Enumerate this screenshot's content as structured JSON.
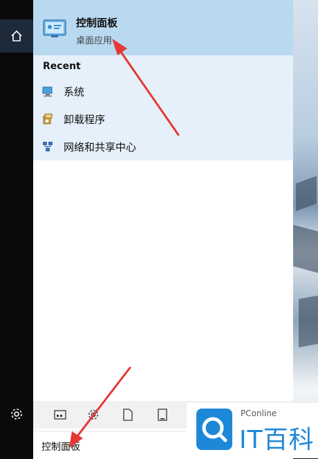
{
  "best_match": {
    "title": "控制面板",
    "subtitle": "桌面应用"
  },
  "recent": {
    "header": "Recent",
    "items": [
      {
        "label": "系统",
        "icon": "computer-icon"
      },
      {
        "label": "卸载程序",
        "icon": "programs-icon"
      },
      {
        "label": "网络和共享中心",
        "icon": "network-icon"
      }
    ]
  },
  "toolbar": {
    "icons": [
      "apps-icon",
      "settings-icon",
      "document-icon",
      "tablet-icon"
    ]
  },
  "search": {
    "value": "控制面板"
  },
  "watermark": {
    "source": "PConline",
    "brand": "IT百科"
  },
  "colors": {
    "accent": "#1e88d8",
    "best_match_bg": "#b9d9f1",
    "recent_bg": "#e6f0fa",
    "arrow": "#e53935"
  }
}
